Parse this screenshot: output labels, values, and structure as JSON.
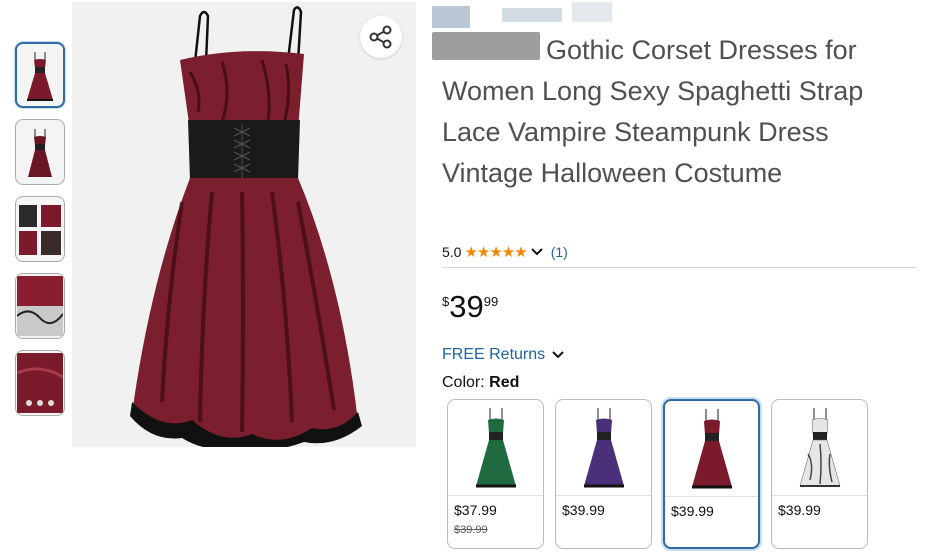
{
  "product": {
    "title": "Gothic Corset Dresses for Women Long Sexy Spaghetti Strap Lace Vampire Steampunk Dress Vintage Halloween Costume",
    "rating_value": "5.0",
    "stars": "★★★★★",
    "rating_count": "(1)",
    "price_symbol": "$",
    "price_whole": "39",
    "price_fraction": "99",
    "free_returns": "FREE Returns",
    "color_label": "Color:",
    "color_value": "Red"
  },
  "icons": {
    "share": "share-icon",
    "chevron": "chevron-down-icon"
  },
  "swatches": [
    {
      "color": "#1f6b3f",
      "price": "$37.99",
      "old_price": "$39.99"
    },
    {
      "color": "#4a2f7a",
      "price": "$39.99"
    },
    {
      "color": "#7a1a2a",
      "price": "$39.99"
    },
    {
      "color": "#d9d9d9",
      "price": "$39.99"
    }
  ],
  "colors": {
    "accent_blue": "#2162a1",
    "star_orange": "#f08804",
    "dress_red": "#7a1a2a"
  }
}
